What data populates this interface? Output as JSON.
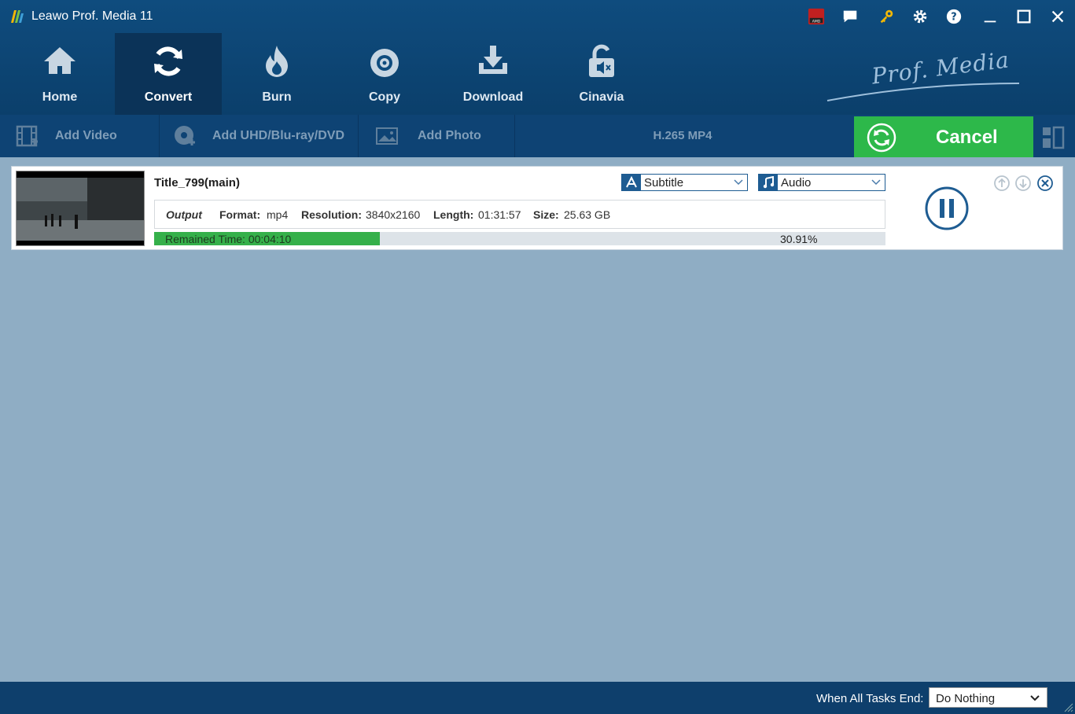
{
  "app": {
    "title": "Leawo Prof. Media 11",
    "brand": "Prof. Media"
  },
  "titlebar": {
    "icons": [
      "amd-icon",
      "chat-icon",
      "key-icon",
      "gear-icon",
      "help-icon",
      "minimize-icon",
      "maximize-icon",
      "close-icon"
    ]
  },
  "nav": {
    "items": [
      {
        "label": "Home",
        "icon": "home-icon"
      },
      {
        "label": "Convert",
        "icon": "convert-icon",
        "active": true
      },
      {
        "label": "Burn",
        "icon": "flame-icon"
      },
      {
        "label": "Copy",
        "icon": "disc-icon"
      },
      {
        "label": "Download",
        "icon": "download-icon"
      },
      {
        "label": "Cinavia",
        "icon": "unlock-icon"
      }
    ]
  },
  "toolbar": {
    "add_video": "Add Video",
    "add_uhd": "Add UHD/Blu-ray/DVD",
    "add_photo": "Add Photo",
    "format": "H.265 MP4",
    "cancel": "Cancel"
  },
  "task": {
    "title": "Title_799(main)",
    "subtitle_label": "Subtitle",
    "audio_label": "Audio",
    "output_label": "Output",
    "format_key": "Format:",
    "format_val": "mp4",
    "resolution_key": "Resolution:",
    "resolution_val": "3840x2160",
    "length_key": "Length:",
    "length_val": "01:31:57",
    "size_key": "Size:",
    "size_val": "25.63 GB",
    "remained": "Remained Time: 00:04:10",
    "percent_text": "30.91%",
    "progress": 0.3091
  },
  "statusbar": {
    "tasks_end_label": "When All Tasks End:",
    "tasks_end_value": "Do Nothing"
  },
  "colors": {
    "accent": "#2db84a",
    "nav_bg": "#0f4c7e",
    "workspace": "#8fadc4"
  }
}
